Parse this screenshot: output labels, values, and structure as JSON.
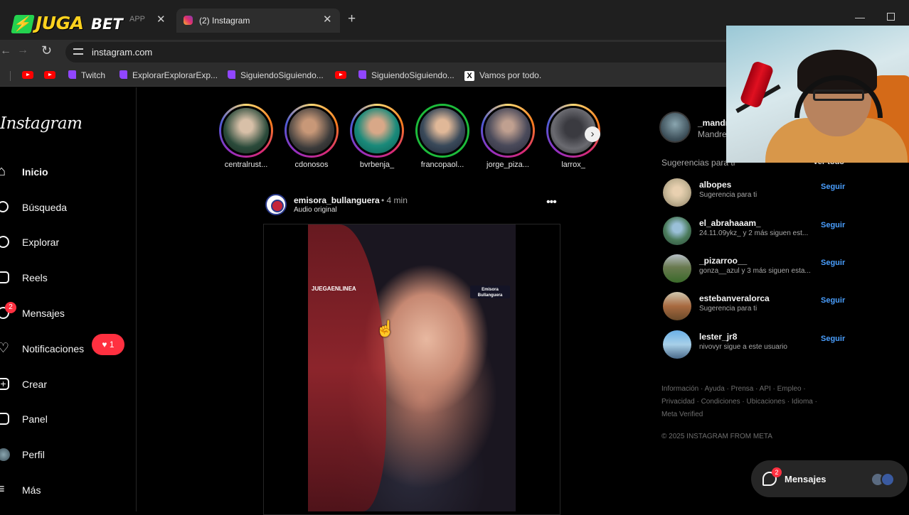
{
  "browser": {
    "tabs": [
      {
        "title": "APP",
        "active": false
      },
      {
        "title": "(2) Instagram",
        "active": true
      }
    ],
    "overlay_logo": {
      "part1": "JUGA",
      "part2": "BET"
    },
    "url": "instagram.com",
    "bookmarks": [
      {
        "label": "",
        "icon": "youtube-icon"
      },
      {
        "label": "",
        "icon": "youtube-icon"
      },
      {
        "label": "Twitch",
        "icon": "twitch-icon"
      },
      {
        "label": "ExplorarExplorarExp...",
        "icon": "twitch-icon"
      },
      {
        "label": "SiguiendoSiguiendo...",
        "icon": "twitch-icon"
      },
      {
        "label": "",
        "icon": "youtube-icon"
      },
      {
        "label": "SiguiendoSiguiendo...",
        "icon": "twitch-icon"
      },
      {
        "label": "Vamos por todo.",
        "icon": "x-icon"
      }
    ]
  },
  "sidebar": {
    "brand": "Instagram",
    "items": [
      {
        "label": "Inicio",
        "icon": "home-icon",
        "active": true
      },
      {
        "label": "Búsqueda",
        "icon": "search-icon"
      },
      {
        "label": "Explorar",
        "icon": "compass-icon"
      },
      {
        "label": "Reels",
        "icon": "reels-icon"
      },
      {
        "label": "Mensajes",
        "icon": "messenger-icon",
        "badge": "2"
      },
      {
        "label": "Notificaciones",
        "icon": "heart-icon",
        "pill": "1"
      },
      {
        "label": "Crear",
        "icon": "plus-square-icon"
      },
      {
        "label": "Panel",
        "icon": "bar-chart-icon"
      },
      {
        "label": "Perfil",
        "icon": "avatar-icon"
      },
      {
        "label": "Más",
        "icon": "menu-icon"
      }
    ]
  },
  "stories": [
    {
      "name": "centralrust...",
      "ring": "gold"
    },
    {
      "name": "cdonosos",
      "ring": "gold"
    },
    {
      "name": "bvrbenja_",
      "ring": "gold"
    },
    {
      "name": "francopaol...",
      "ring": "green"
    },
    {
      "name": "jorge_piza...",
      "ring": "gold"
    },
    {
      "name": "larrox_",
      "ring": "gold"
    }
  ],
  "post": {
    "username": "emisora_bullanguera",
    "time": "• 4 min",
    "audio": "Audio original",
    "overlay_left": "JUEGAENLINEA",
    "overlay_right": "Emisora Bullanguera"
  },
  "account": {
    "username": "_mandr",
    "name": "Mandre"
  },
  "suggestions": {
    "title": "Sugerencias para ti",
    "see_all": "Ver todo",
    "follow_label": "Seguir",
    "items": [
      {
        "username": "albopes",
        "subtitle": "Sugerencia para ti"
      },
      {
        "username": "el_abrahaaam_",
        "subtitle": "24.11.09ykz_ y 2 más siguen est..."
      },
      {
        "username": "_pizarroo__",
        "subtitle": "gonza__azul y 3 más siguen esta..."
      },
      {
        "username": "estebanveralorca",
        "subtitle": "Sugerencia para ti"
      },
      {
        "username": "lester_jr8",
        "subtitle": "nivovyr sigue a este usuario"
      }
    ]
  },
  "footer": {
    "line1": "Información · Ayuda · Prensa · API · Empleo ·",
    "line2": "Privacidad · Condiciones · Ubicaciones · Idioma ·",
    "line3": "Meta Verified",
    "copyright": "© 2025 INSTAGRAM FROM META"
  },
  "messages_float": {
    "label": "Mensajes",
    "badge": "2"
  },
  "colors": {
    "accent_blue": "#4a9fff",
    "notification_red": "#ff3040",
    "background": "#000000"
  }
}
